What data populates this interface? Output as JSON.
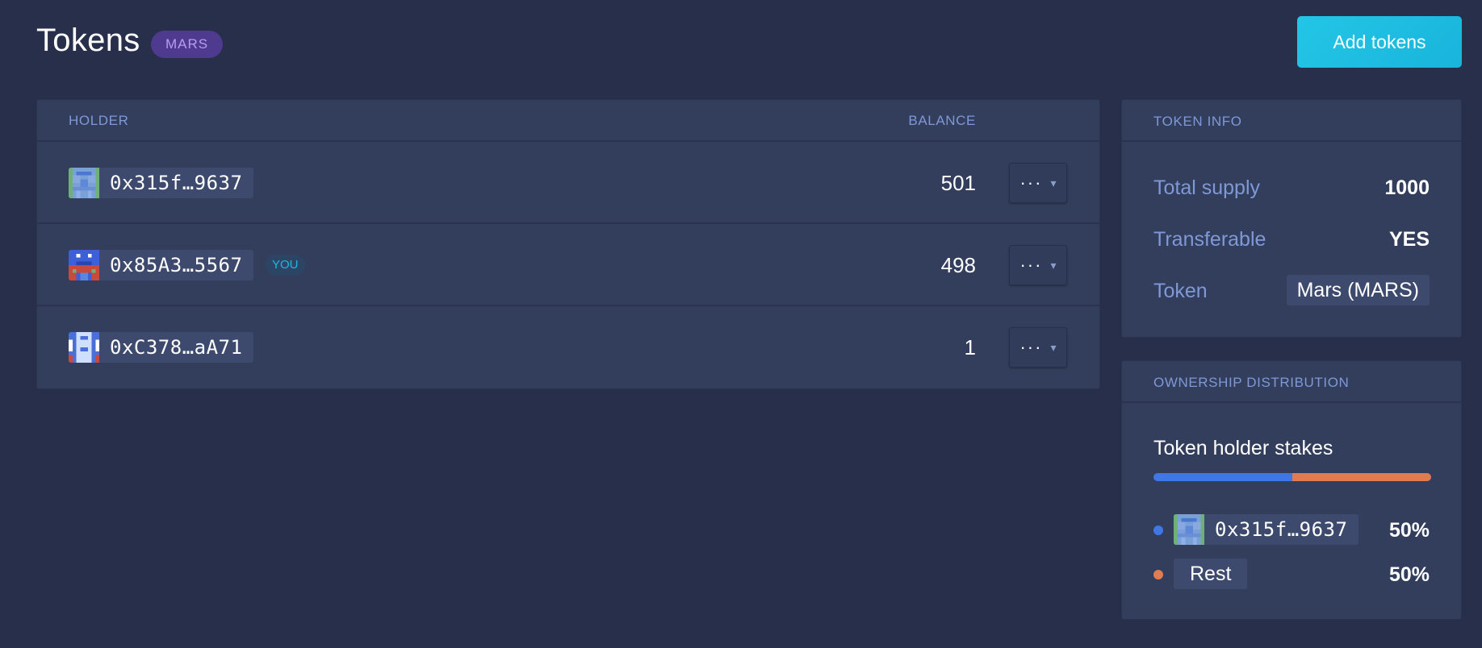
{
  "header": {
    "title": "Tokens",
    "symbol": "MARS",
    "add_button_label": "Add tokens"
  },
  "holders": {
    "columns": {
      "holder": "HOLDER",
      "balance": "BALANCE"
    },
    "rows": [
      {
        "address": "0x315f…9637",
        "balance": "501",
        "is_you": false,
        "you_label": "",
        "menu_icon": "ellipsis-icon",
        "chevron_icon": "chevron-down-icon"
      },
      {
        "address": "0x85A3…5567",
        "balance": "498",
        "is_you": true,
        "you_label": "YOU",
        "menu_icon": "ellipsis-icon",
        "chevron_icon": "chevron-down-icon"
      },
      {
        "address": "0xC378…aA71",
        "balance": "1",
        "is_you": false,
        "you_label": "",
        "menu_icon": "ellipsis-icon",
        "chevron_icon": "chevron-down-icon"
      }
    ]
  },
  "token_info": {
    "title": "TOKEN INFO",
    "rows": [
      {
        "key": "Total supply",
        "value": "1000"
      },
      {
        "key": "Transferable",
        "value": "YES"
      },
      {
        "key": "Token",
        "value": "Mars (MARS)"
      }
    ]
  },
  "ownership": {
    "title": "OWNERSHIP DISTRIBUTION",
    "heading": "Token holder stakes",
    "entries": [
      {
        "label": "0x315f…9637",
        "percent": "50%",
        "share": 0.5,
        "color": "#3f78e6"
      },
      {
        "label": "Rest",
        "percent": "50%",
        "share": 0.5,
        "color": "#e07b52"
      }
    ]
  },
  "colors": {
    "background": "#272f4a",
    "panel": "#323e5c",
    "accent": "#1fc0e4",
    "symbol_badge": "#4e3a8e",
    "muted_label": "#7f98d6"
  }
}
